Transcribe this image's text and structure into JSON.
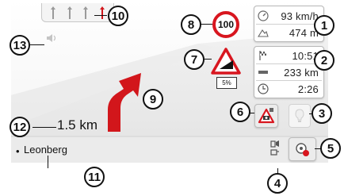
{
  "callouts": [
    "1",
    "2",
    "3",
    "4",
    "5",
    "6",
    "7",
    "8",
    "9",
    "10",
    "11",
    "12",
    "13"
  ],
  "speed_limit": "100",
  "top_panel": {
    "speed": "93 km/h",
    "altitude": "474 m"
  },
  "route_panel": {
    "arrival_time": "10:51",
    "remaining_distance": "233 km",
    "remaining_time": "2:26"
  },
  "gradient_sign": {
    "value": "5%"
  },
  "maneuver": {
    "distance": "1.5 km"
  },
  "street": {
    "name": "Leonberg",
    "bullet": "•"
  },
  "icons": {
    "lane_arrows": "lane-arrow-icons",
    "volume": "speaker-icon",
    "speed": "speedometer-icon",
    "altitude": "altitude-icon",
    "arrival": "finish-flag-icon",
    "distance": "road-icon",
    "time": "clock-icon",
    "speed_camera": "speed-camera-icon",
    "lane_light": "lightbulb-icon",
    "gps": "gps-status-icon",
    "options": "options-icon"
  },
  "colors": {
    "turn_arrow": "#d2161b",
    "speed_limit_ring": "#d8161f",
    "warning_border": "#d8161f"
  }
}
